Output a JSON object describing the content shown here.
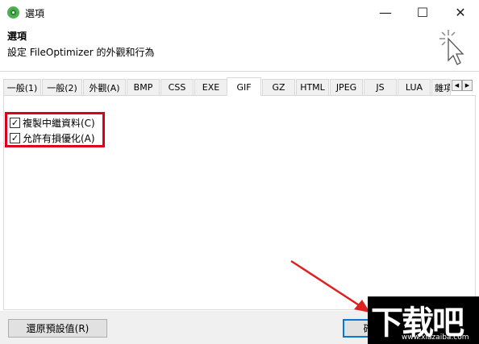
{
  "window": {
    "title": "選項",
    "minimize_glyph": "—",
    "maximize_glyph": "☐",
    "close_glyph": "✕"
  },
  "header": {
    "title": "選項",
    "subtitle": "設定 FileOptimizer 的外觀和行為",
    "icon": "cursor-click-icon"
  },
  "tabs": [
    {
      "label": "一般(1)",
      "active": false
    },
    {
      "label": "一般(2)",
      "active": false
    },
    {
      "label": "外觀(A)",
      "active": false
    },
    {
      "label": "BMP",
      "active": false
    },
    {
      "label": "CSS",
      "active": false
    },
    {
      "label": "EXE",
      "active": false
    },
    {
      "label": "GIF",
      "active": true
    },
    {
      "label": "GZ",
      "active": false
    },
    {
      "label": "HTML",
      "active": false
    },
    {
      "label": "JPEG",
      "active": false
    },
    {
      "label": "JS",
      "active": false
    },
    {
      "label": "LUA",
      "active": false
    },
    {
      "label": "雜項",
      "active": false
    }
  ],
  "tab_scroll": {
    "left": "◀",
    "right": "▶"
  },
  "gif_options": [
    {
      "label": "複製中繼資料(C)",
      "checked": true
    },
    {
      "label": "允許有損優化(A)",
      "checked": true
    }
  ],
  "buttons": {
    "reset": "還原預設值(R)",
    "ok": "確定"
  },
  "watermark": {
    "text": "下载吧",
    "url": "www.xiazaiba.com"
  },
  "colors": {
    "highlight": "#d9001b",
    "arrow": "#e02020",
    "accent": "#0078d7"
  }
}
